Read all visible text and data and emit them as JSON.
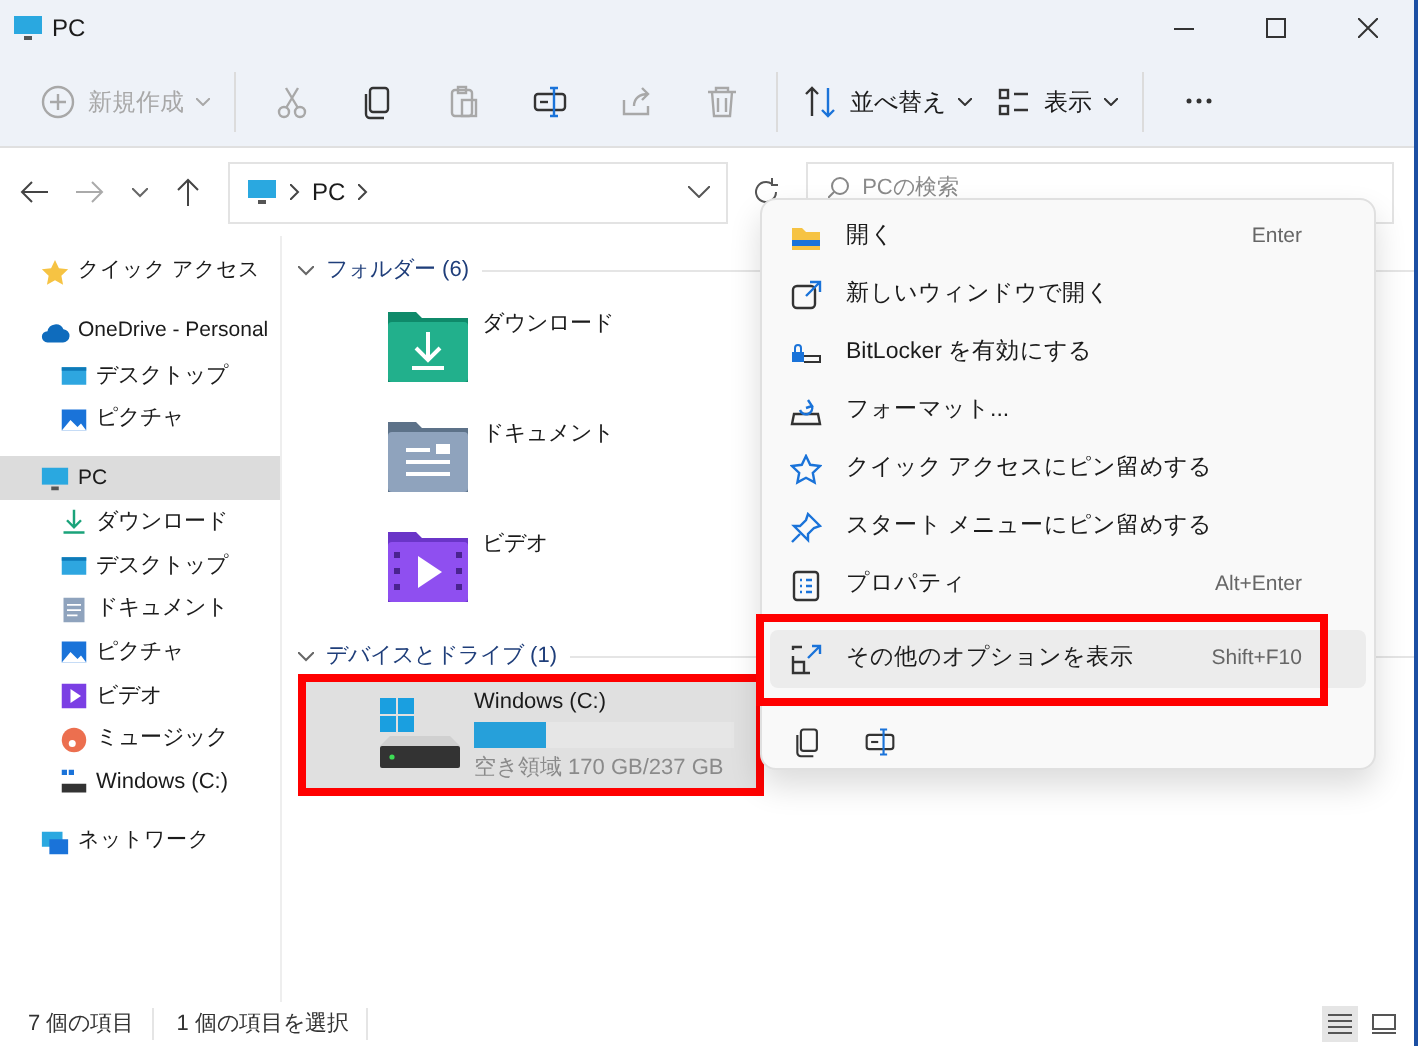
{
  "window": {
    "title": "PC"
  },
  "toolbar": [
    {
      "kind": "new",
      "label": "新規作成",
      "disabled": true
    },
    {
      "kind": "cut",
      "disabled": true
    },
    {
      "kind": "copy",
      "disabled": false
    },
    {
      "kind": "paste",
      "disabled": true
    },
    {
      "kind": "rename",
      "disabled": false
    },
    {
      "kind": "share",
      "disabled": true
    },
    {
      "kind": "delete",
      "disabled": true
    },
    {
      "kind": "sort",
      "label": "並べ替え",
      "disabled": false
    },
    {
      "kind": "view",
      "label": "表示",
      "disabled": false
    },
    {
      "kind": "more",
      "disabled": false
    }
  ],
  "address": {
    "path": [
      "PC"
    ]
  },
  "search": {
    "placeholder": "PCの検索"
  },
  "sidebar": {
    "items": [
      {
        "kind": "star",
        "label": "クイック アクセス",
        "selected": false
      },
      {
        "kind": "cloud",
        "label": "OneDrive - Personal",
        "selected": false,
        "children": [
          {
            "kind": "desktop",
            "label": "デスクトップ",
            "selected": false
          },
          {
            "kind": "picture",
            "label": "ピクチャ",
            "selected": false
          }
        ]
      },
      {
        "kind": "pc",
        "label": "PC",
        "selected": true,
        "children": [
          {
            "kind": "download",
            "label": "ダウンロード",
            "selected": false
          },
          {
            "kind": "desktop",
            "label": "デスクトップ",
            "selected": false
          },
          {
            "kind": "document",
            "label": "ドキュメント",
            "selected": false
          },
          {
            "kind": "picture",
            "label": "ピクチャ",
            "selected": false
          },
          {
            "kind": "video",
            "label": "ビデオ",
            "selected": false
          },
          {
            "kind": "music",
            "label": "ミュージック",
            "selected": false
          },
          {
            "kind": "drive",
            "label": "Windows (C:)",
            "selected": false
          }
        ]
      },
      {
        "kind": "network",
        "label": "ネットワーク",
        "selected": false
      }
    ]
  },
  "sections": [
    {
      "title": "フォルダー (6)",
      "items": [
        {
          "kind": "download",
          "label": "ダウンロード"
        },
        {
          "kind": "document",
          "label": "ドキュメント"
        },
        {
          "kind": "video",
          "label": "ビデオ"
        }
      ]
    },
    {
      "title": "デバイスとドライブ (1)",
      "items": [
        {
          "kind": "drive",
          "label": "Windows (C:)",
          "level": 0.28,
          "free": "空き領域 170 GB/237 GB",
          "selected": true,
          "highlighted": true
        }
      ]
    }
  ],
  "context_menu": {
    "items": [
      {
        "kind": "folder",
        "label": "開く",
        "shortcut": "Enter",
        "selected": false,
        "highlighted": false
      },
      {
        "kind": "newwindow",
        "label": "新しいウィンドウで開く",
        "selected": false,
        "highlighted": false
      },
      {
        "kind": "lock",
        "label": "BitLocker を有効にする",
        "selected": false,
        "highlighted": false
      },
      {
        "kind": "format",
        "label": "フォーマット...",
        "selected": false,
        "highlighted": false
      },
      {
        "kind": "star",
        "label": "クイック アクセスにピン留めする",
        "selected": false,
        "highlighted": false
      },
      {
        "kind": "pin",
        "label": "スタート メニューにピン留めする",
        "selected": false,
        "highlighted": false
      },
      {
        "kind": "props",
        "label": "プロパティ",
        "shortcut": "Alt+Enter",
        "selected": false,
        "highlighted": false
      },
      {
        "kind": "more",
        "label": "その他のオプションを表示",
        "shortcut": "Shift+F10",
        "selected": true,
        "highlighted": true
      }
    ],
    "bottom_icons": [
      {
        "kind": "copy"
      },
      {
        "kind": "rename"
      }
    ]
  },
  "status_bar": {
    "items": [
      "7 個の項目",
      "1 個の項目を選択"
    ],
    "view_buttons": [
      {
        "kind": "details",
        "selected": true
      },
      {
        "kind": "tiles",
        "selected": false
      }
    ]
  }
}
